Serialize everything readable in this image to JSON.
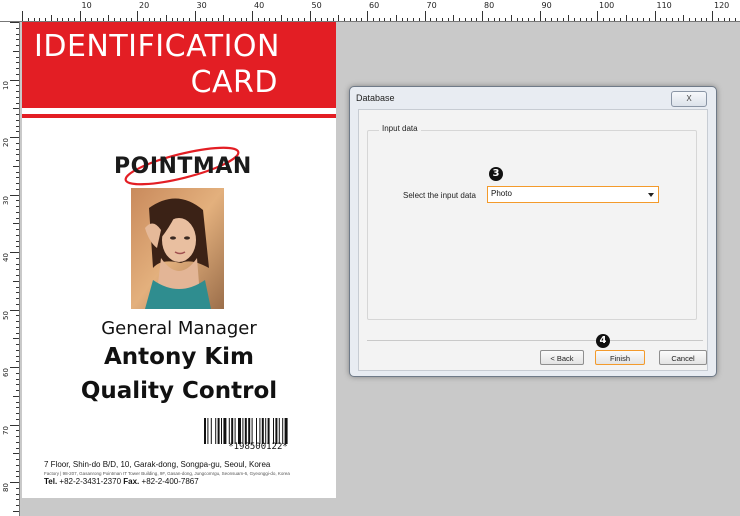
{
  "ruler": {
    "top_numbers": [
      "10",
      "20",
      "30",
      "40",
      "50",
      "60",
      "70",
      "80",
      "90",
      "100",
      "110",
      "120"
    ],
    "left_numbers": [
      "10",
      "20",
      "30",
      "40",
      "50",
      "60",
      "70",
      "80"
    ]
  },
  "card": {
    "header_line1": "IDENTIFICATION",
    "header_line2": "CARD",
    "logo": "POINTMAN",
    "job_title": "General Manager",
    "name": "Antony Kim",
    "department": "Quality Control",
    "barcode_number": "*198500122*",
    "address": "7 Floor, Shin-do B/D, 10, Garak-dong, Songpa-gu, Seoul, Korea",
    "address_small": "Factory | 98-207, Gasanrong Pointman IT Tower Building, 9F, Gasan-dong, Jungcomrgu, Seonsuam-6, Gyeonggi-do, Korea",
    "tel_label": "Tel.",
    "tel": "+82-2-3431-2370",
    "fax_label": "Fax.",
    "fax": "+82-2-400-7867",
    "colors": {
      "header_red": "#e31e24"
    }
  },
  "dialog": {
    "title": "Database",
    "close_label": "X",
    "group_legend": "Input data",
    "input_label": "Select the input data",
    "input_value": "Photo",
    "step3": "3",
    "step4": "4",
    "back_label": "< Back",
    "finish_label": "Finish",
    "cancel_label": "Cancel",
    "colors": {
      "highlight": "#f39a2b"
    }
  }
}
